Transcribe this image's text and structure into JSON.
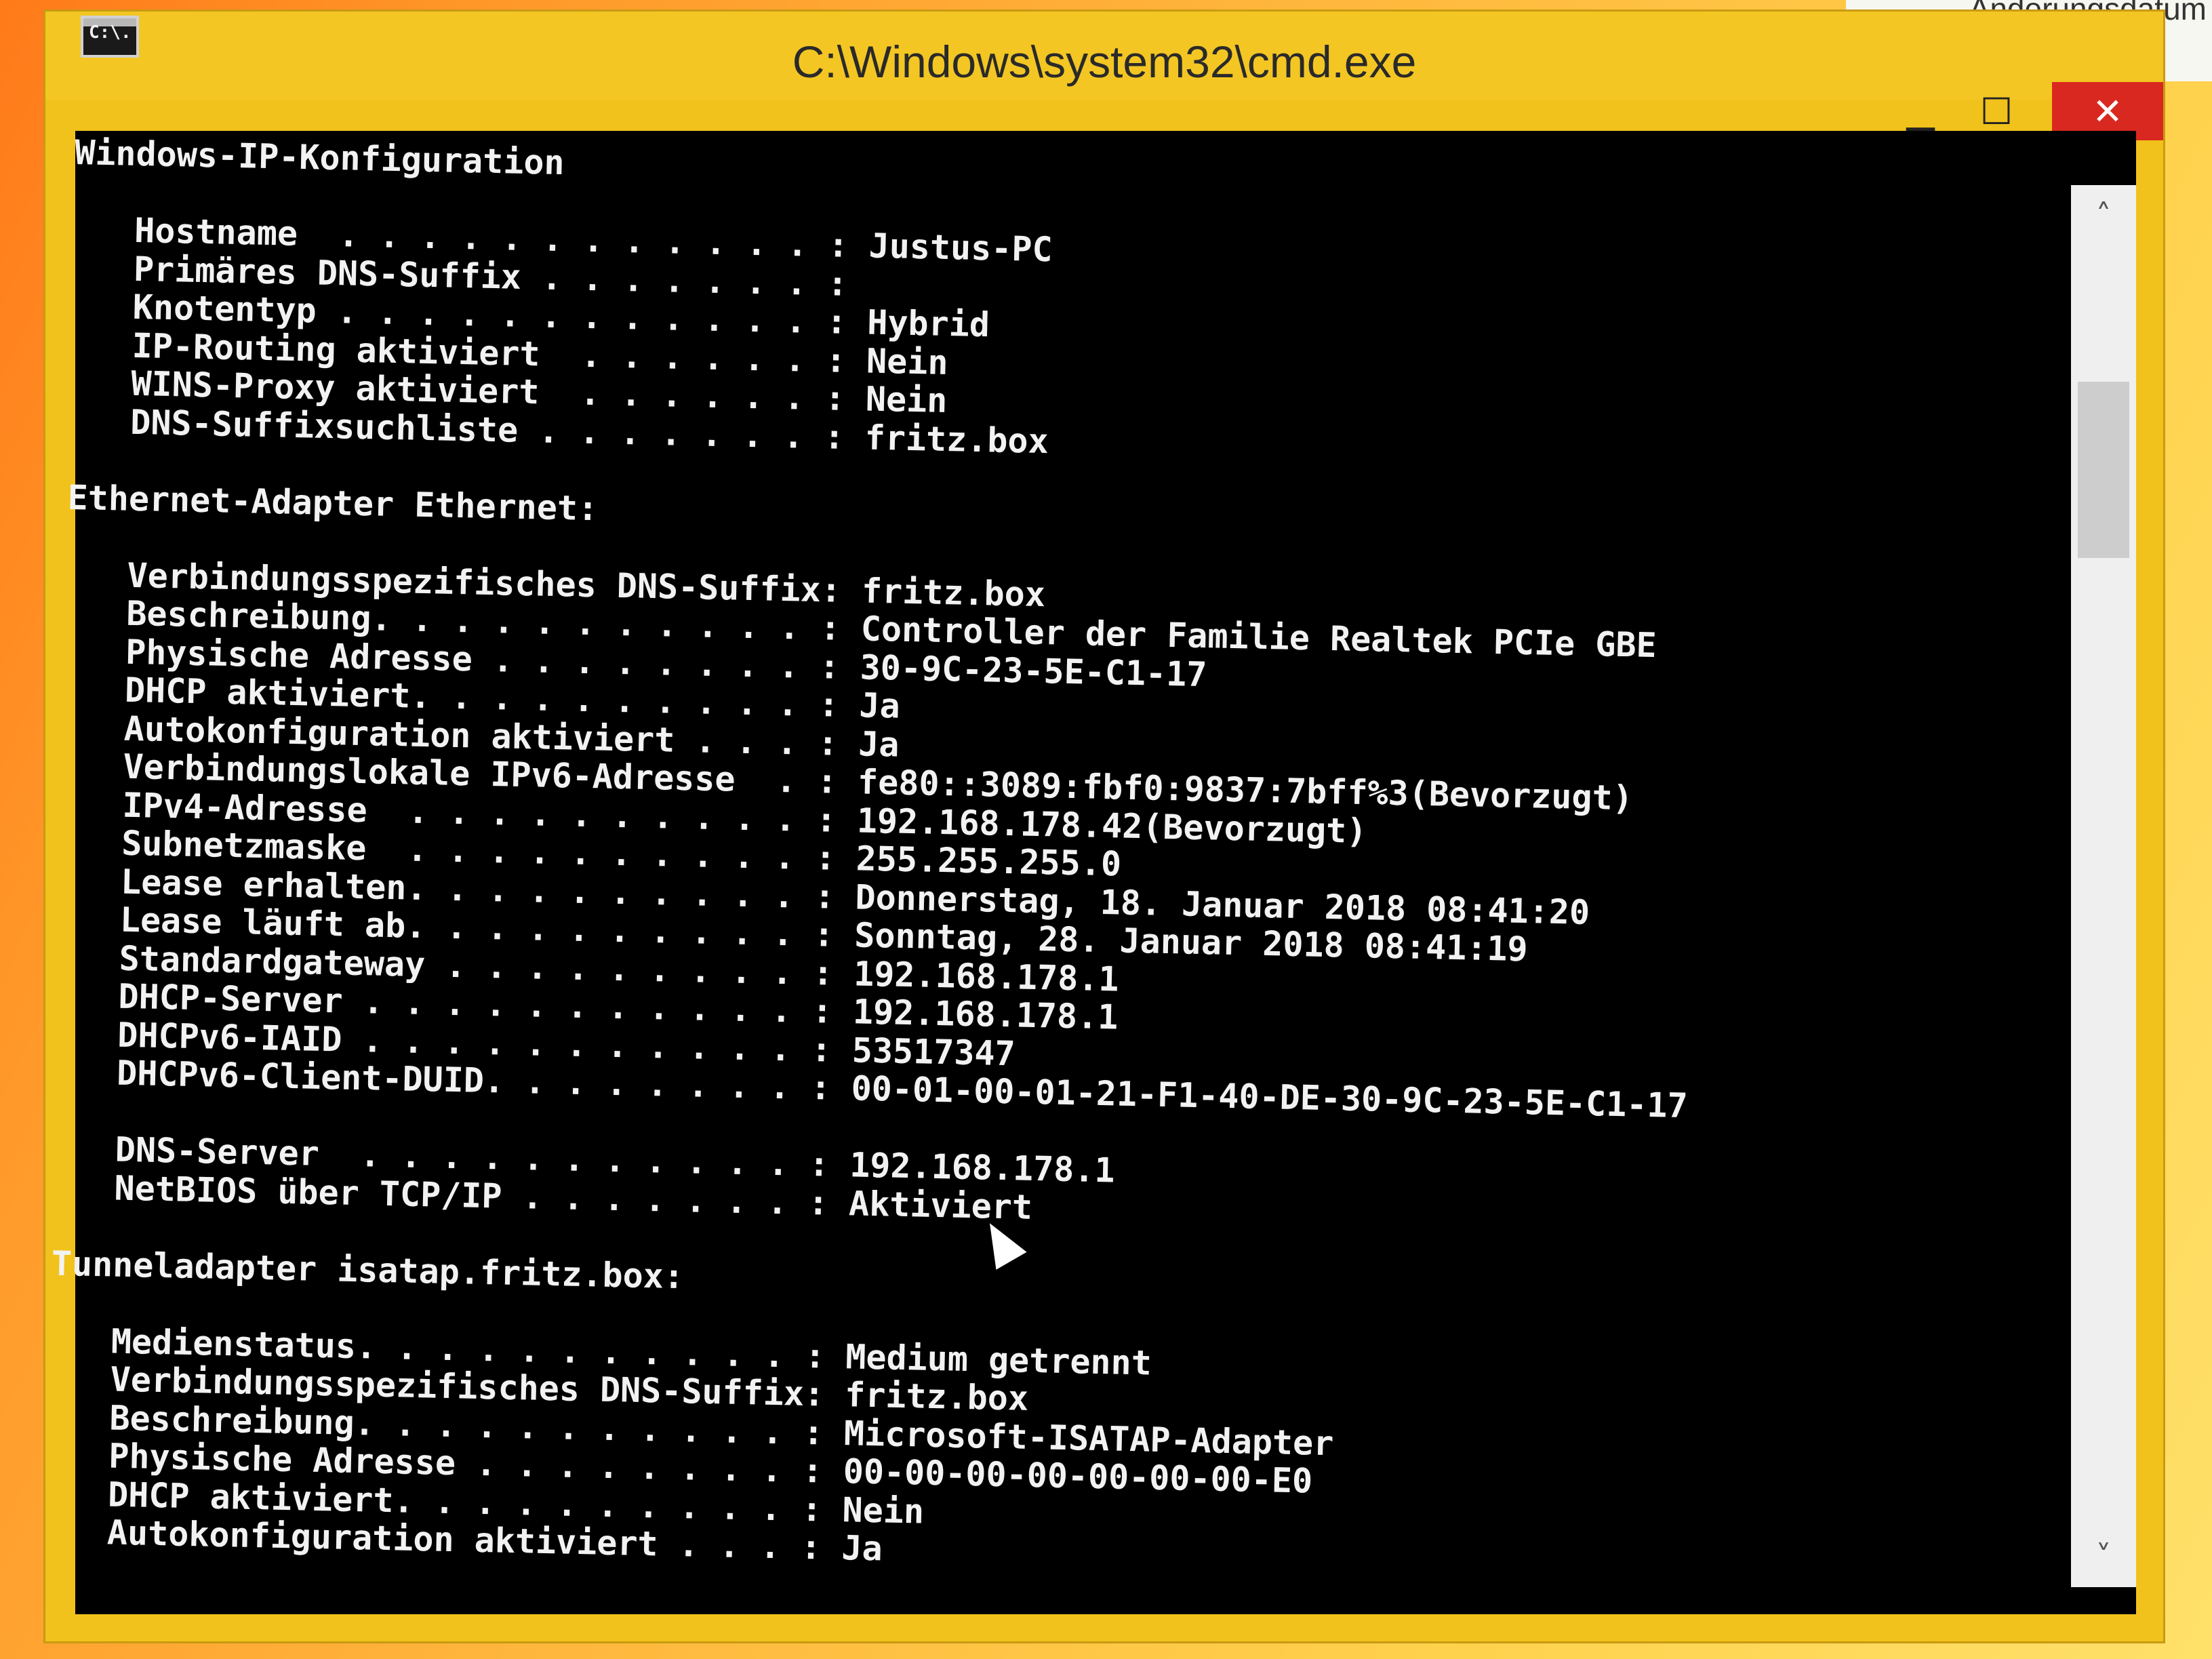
{
  "background_window": {
    "column_header": "Änderungsdatum"
  },
  "window": {
    "title": "C:\\Windows\\system32\\cmd.exe",
    "icon_label": "C:\\.",
    "buttons": {
      "minimize": "▁",
      "maximize": "☐",
      "close": "✕"
    }
  },
  "console": {
    "lines": [
      "Windows-IP-Konfiguration",
      "",
      "   Hostname  . . . . . . . . . . . . : Justus-PC",
      "   Primäres DNS-Suffix . . . . . . . :",
      "   Knotentyp . . . . . . . . . . . . : Hybrid",
      "   IP-Routing aktiviert  . . . . . . : Nein",
      "   WINS-Proxy aktiviert  . . . . . . : Nein",
      "   DNS-Suffixsuchliste . . . . . . . : fritz.box",
      "",
      "Ethernet-Adapter Ethernet:",
      "",
      "   Verbindungsspezifisches DNS-Suffix: fritz.box",
      "   Beschreibung. . . . . . . . . . . : Controller der Familie Realtek PCIe GBE",
      "   Physische Adresse . . . . . . . . : 30-9C-23-5E-C1-17",
      "   DHCP aktiviert. . . . . . . . . . : Ja",
      "   Autokonfiguration aktiviert . . . : Ja",
      "   Verbindungslokale IPv6-Adresse  . : fe80::3089:fbf0:9837:7bff%3(Bevorzugt)",
      "   IPv4-Adresse  . . . . . . . . . . : 192.168.178.42(Bevorzugt)",
      "   Subnetzmaske  . . . . . . . . . . : 255.255.255.0",
      "   Lease erhalten. . . . . . . . . . : Donnerstag, 18. Januar 2018 08:41:20",
      "   Lease läuft ab. . . . . . . . . . : Sonntag, 28. Januar 2018 08:41:19",
      "   Standardgateway . . . . . . . . . : 192.168.178.1",
      "   DHCP-Server . . . . . . . . . . . : 192.168.178.1",
      "   DHCPv6-IAID . . . . . . . . . . . : 53517347",
      "   DHCPv6-Client-DUID. . . . . . . . : 00-01-00-01-21-F1-40-DE-30-9C-23-5E-C1-17",
      "",
      "   DNS-Server  . . . . . . . . . . . : 192.168.178.1",
      "   NetBIOS über TCP/IP . . . . . . . : Aktiviert",
      "",
      "Tunneladapter isatap.fritz.box:",
      "",
      "   Medienstatus. . . . . . . . . . . : Medium getrennt",
      "   Verbindungsspezifisches DNS-Suffix: fritz.box",
      "   Beschreibung. . . . . . . . . . . : Microsoft-ISATAP-Adapter",
      "   Physische Adresse . . . . . . . . : 00-00-00-00-00-00-00-E0",
      "   DHCP aktiviert. . . . . . . . . . : Nein",
      "   Autokonfiguration aktiviert . . . : Ja"
    ]
  },
  "scrollbar": {
    "up_arrow": "˄",
    "down_arrow": "˅"
  },
  "colors": {
    "console_bg": "#000000",
    "console_fg": "#f2f2f2",
    "titlebar": "#f3c623",
    "close": "#d9281f"
  }
}
